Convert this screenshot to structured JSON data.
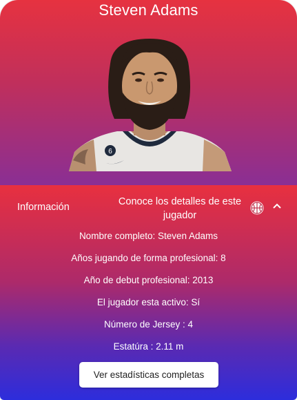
{
  "player": {
    "name": "Steven Adams",
    "jersey_on_photo": "6"
  },
  "accordion": {
    "title": "Información",
    "subtitle": "Conoce los detalles de este jugador",
    "expanded": true,
    "icons": [
      "basketball-icon",
      "chevron-up-icon"
    ]
  },
  "details": [
    "Nombre completo: Steven Adams",
    "Años jugando de forma profesional: 8",
    "Año de debut profesional: 2013",
    "El jugador esta activo: Sí",
    "Número de Jersey : 4",
    "Estatúra : 2.11 m"
  ],
  "actions": {
    "stats_button": "Ver estadísticas completas"
  },
  "colors": {
    "gradient_top": "#e63240",
    "gradient_mid": "#8a2f94",
    "gradient_bottom": "#2d2ddc"
  }
}
